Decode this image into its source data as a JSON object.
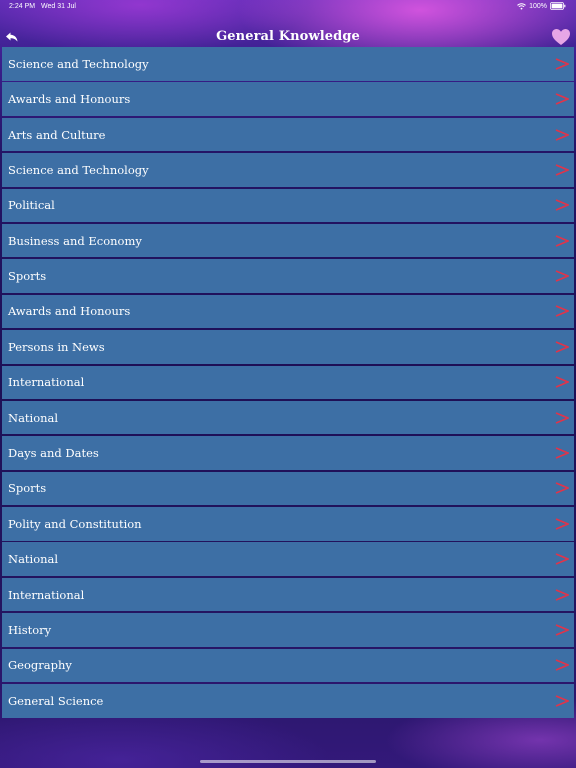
{
  "status_bar": {
    "time": "2:24 PM",
    "date": "Wed 31 Jul",
    "battery": "100%"
  },
  "nav": {
    "title": "General Knowledge",
    "back_icon": "back-arrow-icon",
    "favorite_icon": "heart-icon"
  },
  "colors": {
    "row_background": "#3d6fa5",
    "chevron": "#e0344a",
    "heart": "#e7a6e6"
  },
  "categories": [
    {
      "label": "Science and Technology"
    },
    {
      "label": "Awards and Honours"
    },
    {
      "label": "Arts and Culture"
    },
    {
      "label": "Science and Technology"
    },
    {
      "label": "Political"
    },
    {
      "label": "Business and Economy"
    },
    {
      "label": "Sports"
    },
    {
      "label": "Awards and Honours"
    },
    {
      "label": "Persons in News"
    },
    {
      "label": "International"
    },
    {
      "label": "National"
    },
    {
      "label": "Days and Dates"
    },
    {
      "label": "Sports"
    },
    {
      "label": "Polity and Constitution"
    },
    {
      "label": "National"
    },
    {
      "label": "International"
    },
    {
      "label": "History"
    },
    {
      "label": "Geography"
    },
    {
      "label": "General Science"
    }
  ]
}
